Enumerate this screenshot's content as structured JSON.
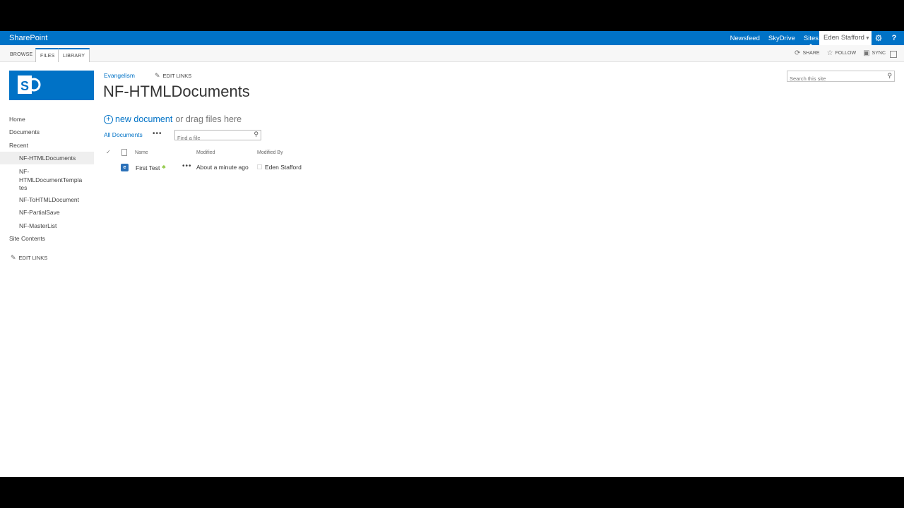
{
  "suitebar": {
    "brand": "SharePoint",
    "links": [
      "Newsfeed",
      "SkyDrive",
      "Sites"
    ],
    "active_link": "Sites",
    "user": "Eden Stafford",
    "help": "?"
  },
  "ribbon": {
    "tabs": [
      "BROWSE",
      "FILES",
      "LIBRARY"
    ],
    "actions": {
      "share": "SHARE",
      "follow": "FOLLOW",
      "sync": "SYNC"
    }
  },
  "header": {
    "breadcrumb": "Evangelism",
    "edit_links": "EDIT LINKS",
    "title": "NF-HTMLDocuments",
    "search_placeholder": "Search this site"
  },
  "leftnav": {
    "home": "Home",
    "documents": "Documents",
    "recent": "Recent",
    "recent_items": [
      "NF-HTMLDocuments",
      "NF-HTMLDocumentTemplates",
      "NF-ToHTMLDocument",
      "NF-PartialSave",
      "NF-MasterList"
    ],
    "multiline_lines": [
      "NF-",
      "HTMLDocumentTempla",
      "tes"
    ],
    "site_contents": "Site Contents",
    "edit_links": "EDIT LINKS"
  },
  "library": {
    "new_document": "new document",
    "drag_text": "or drag files here",
    "view": "All Documents",
    "view_more": "•••",
    "find_placeholder": "Find a file",
    "columns": {
      "name": "Name",
      "modified": "Modified",
      "modified_by": "Modified By"
    },
    "rows": [
      {
        "name": "First Test",
        "modified": "About a minute ago",
        "modified_by": "Eden Stafford"
      }
    ]
  },
  "colors": {
    "suite_blue": "#0072c6",
    "new_badge": "#8cc63e"
  }
}
